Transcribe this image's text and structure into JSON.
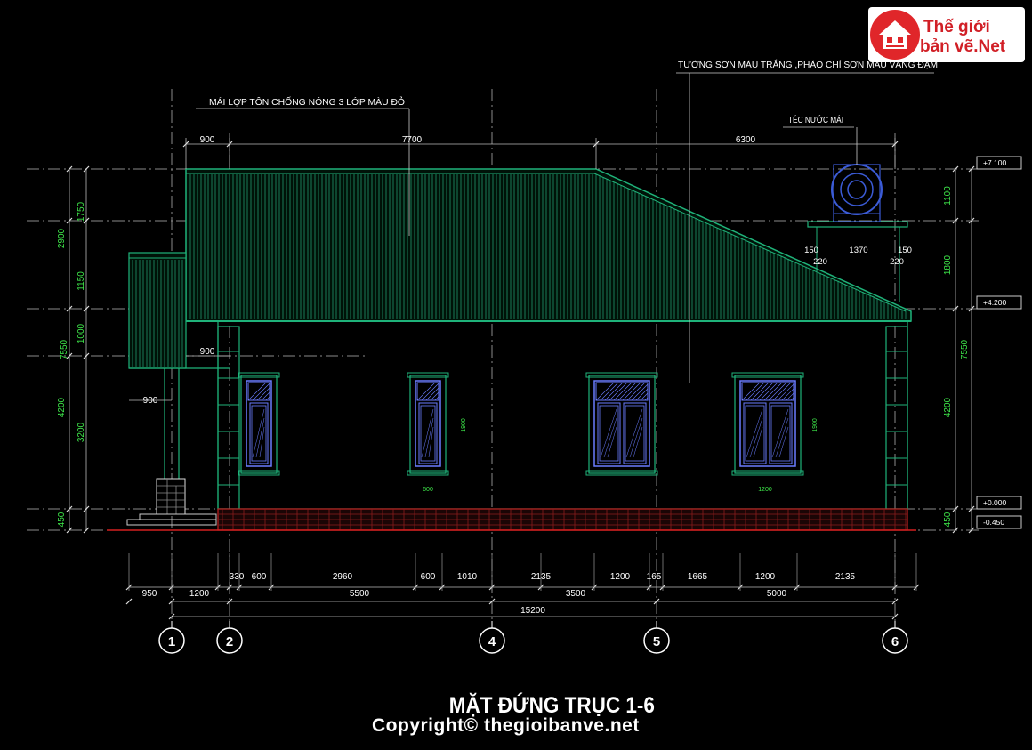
{
  "logo": {
    "line1": "Thế giới",
    "line2": "bản vẽ.Net"
  },
  "notes": {
    "roof": "MÁI LỢP TÔN CHỐNG NÓNG 3 LỚP MÀU ĐỎ",
    "wall": "TƯỜNG SƠN MÀU TRẮNG ,PHÀO CHỈ SƠN MÀU VÀNG ĐẬM",
    "tank": "TÉC NƯỚC MÁI"
  },
  "top_dims": [
    "900",
    "7700",
    "6300"
  ],
  "tank_dims": [
    "150",
    "1370",
    "150",
    "220",
    "220"
  ],
  "roof_dims": [
    "900",
    "900"
  ],
  "left_dims_outer": [
    "7550",
    "2900",
    "4200",
    "450"
  ],
  "left_dims_inner": [
    "1750",
    "1150",
    "1000",
    "3200"
  ],
  "right_dims": [
    "1100",
    "1800",
    "7550",
    "4200",
    "450"
  ],
  "levels": [
    "+7.100",
    "+4.200",
    "+0.000",
    "-0.450"
  ],
  "window_dims": [
    "600",
    "1200",
    "1900",
    "1900"
  ],
  "bottom_dims_row1": [
    "330",
    "600",
    "2960",
    "600",
    "1010",
    "2135",
    "1200",
    "165",
    "1665",
    "1200",
    "2135"
  ],
  "bottom_dims_row2": [
    "950",
    "1200",
    "5500",
    "3500",
    "5000"
  ],
  "bottom_total": "15200",
  "axes": [
    "1",
    "2",
    "4",
    "5",
    "6"
  ],
  "title": "MẶT ĐỨNG TRỤC 1-6",
  "copyright": "Copyright© thegioibanve.net"
}
